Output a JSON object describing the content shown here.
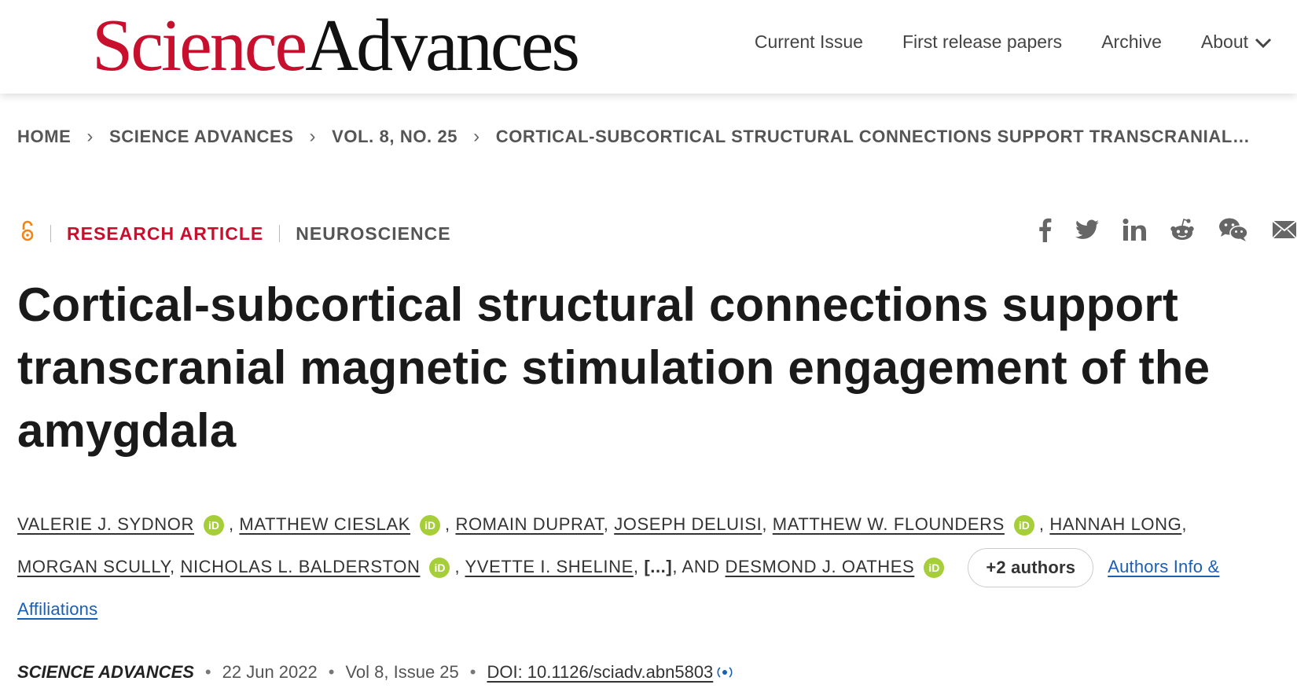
{
  "logo": {
    "part1": "Science",
    "part2": "Advances"
  },
  "nav": {
    "items": [
      "Current Issue",
      "First release papers",
      "Archive",
      "About"
    ]
  },
  "breadcrumb": {
    "items": [
      "HOME",
      "SCIENCE ADVANCES",
      "VOL. 8, NO. 25",
      "CORTICAL-SUBCORTICAL STRUCTURAL CONNECTIONS SUPPORT TRANSCRANIAL…"
    ]
  },
  "article": {
    "type": "RESEARCH ARTICLE",
    "subject": "NEUROSCIENCE",
    "title": "Cortical-subcortical structural connections support transcranial magnetic stimulation engagement of the amygdala"
  },
  "share": {
    "icons": [
      "facebook-icon",
      "twitter-icon",
      "linkedin-icon",
      "reddit-icon",
      "wechat-icon",
      "email-icon"
    ]
  },
  "authors": {
    "list": [
      {
        "name": "VALERIE J. SYDNOR"
      },
      {
        "name": "MATTHEW CIESLAK"
      },
      {
        "name": "ROMAIN DUPRAT"
      },
      {
        "name": "JOSEPH DELUISI"
      },
      {
        "name": "MATTHEW W. FLOUNDERS"
      },
      {
        "name": "HANNAH LONG"
      },
      {
        "name": "MORGAN SCULLY"
      },
      {
        "name": "NICHOLAS L. BALDERSTON"
      },
      {
        "name": "YVETTE I. SHELINE"
      },
      {
        "name": "DESMOND J. OATHES"
      }
    ],
    "ellipsis": "[...]",
    "and": "AND",
    "more_button": "+2 authors",
    "info_link": "Authors Info & Affiliations",
    "orcid_label": "iD"
  },
  "meta": {
    "journal": "SCIENCE ADVANCES",
    "date": "22 Jun 2022",
    "volume": "Vol 8, Issue 25",
    "doi": "DOI: 10.1126/sciadv.abn5803"
  },
  "colors": {
    "brand_red": "#c8102e",
    "orcid_green": "#a6ce39",
    "link_blue": "#1a5fb4",
    "open_access_orange": "#f68212"
  }
}
